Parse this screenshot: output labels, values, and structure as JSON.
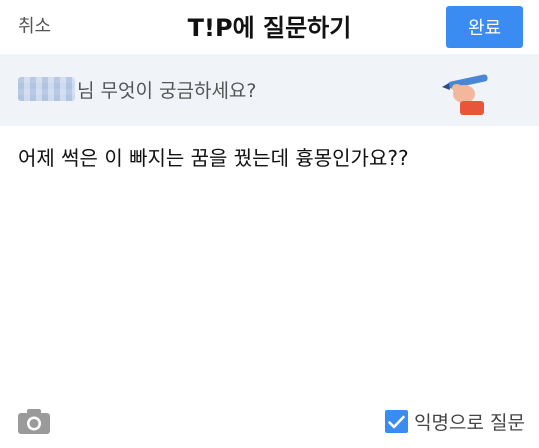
{
  "header": {
    "cancel_label": "취소",
    "title": "T!P에 질문하기",
    "done_label": "완료"
  },
  "banner": {
    "prompt_suffix": "님 무엇이 궁금하세요?"
  },
  "question": {
    "text": "어제 썩은 이 빠지는 꿈을 꿨는데 흉몽인가요??"
  },
  "footer": {
    "anonymous_label": "익명으로 질문",
    "anonymous_checked": true
  },
  "colors": {
    "accent": "#3b8cf2",
    "banner_bg": "#f0f4f9"
  },
  "icons": {
    "attach": "camera-icon",
    "illustration": "hand-pen-icon",
    "checkbox": "check-icon"
  }
}
